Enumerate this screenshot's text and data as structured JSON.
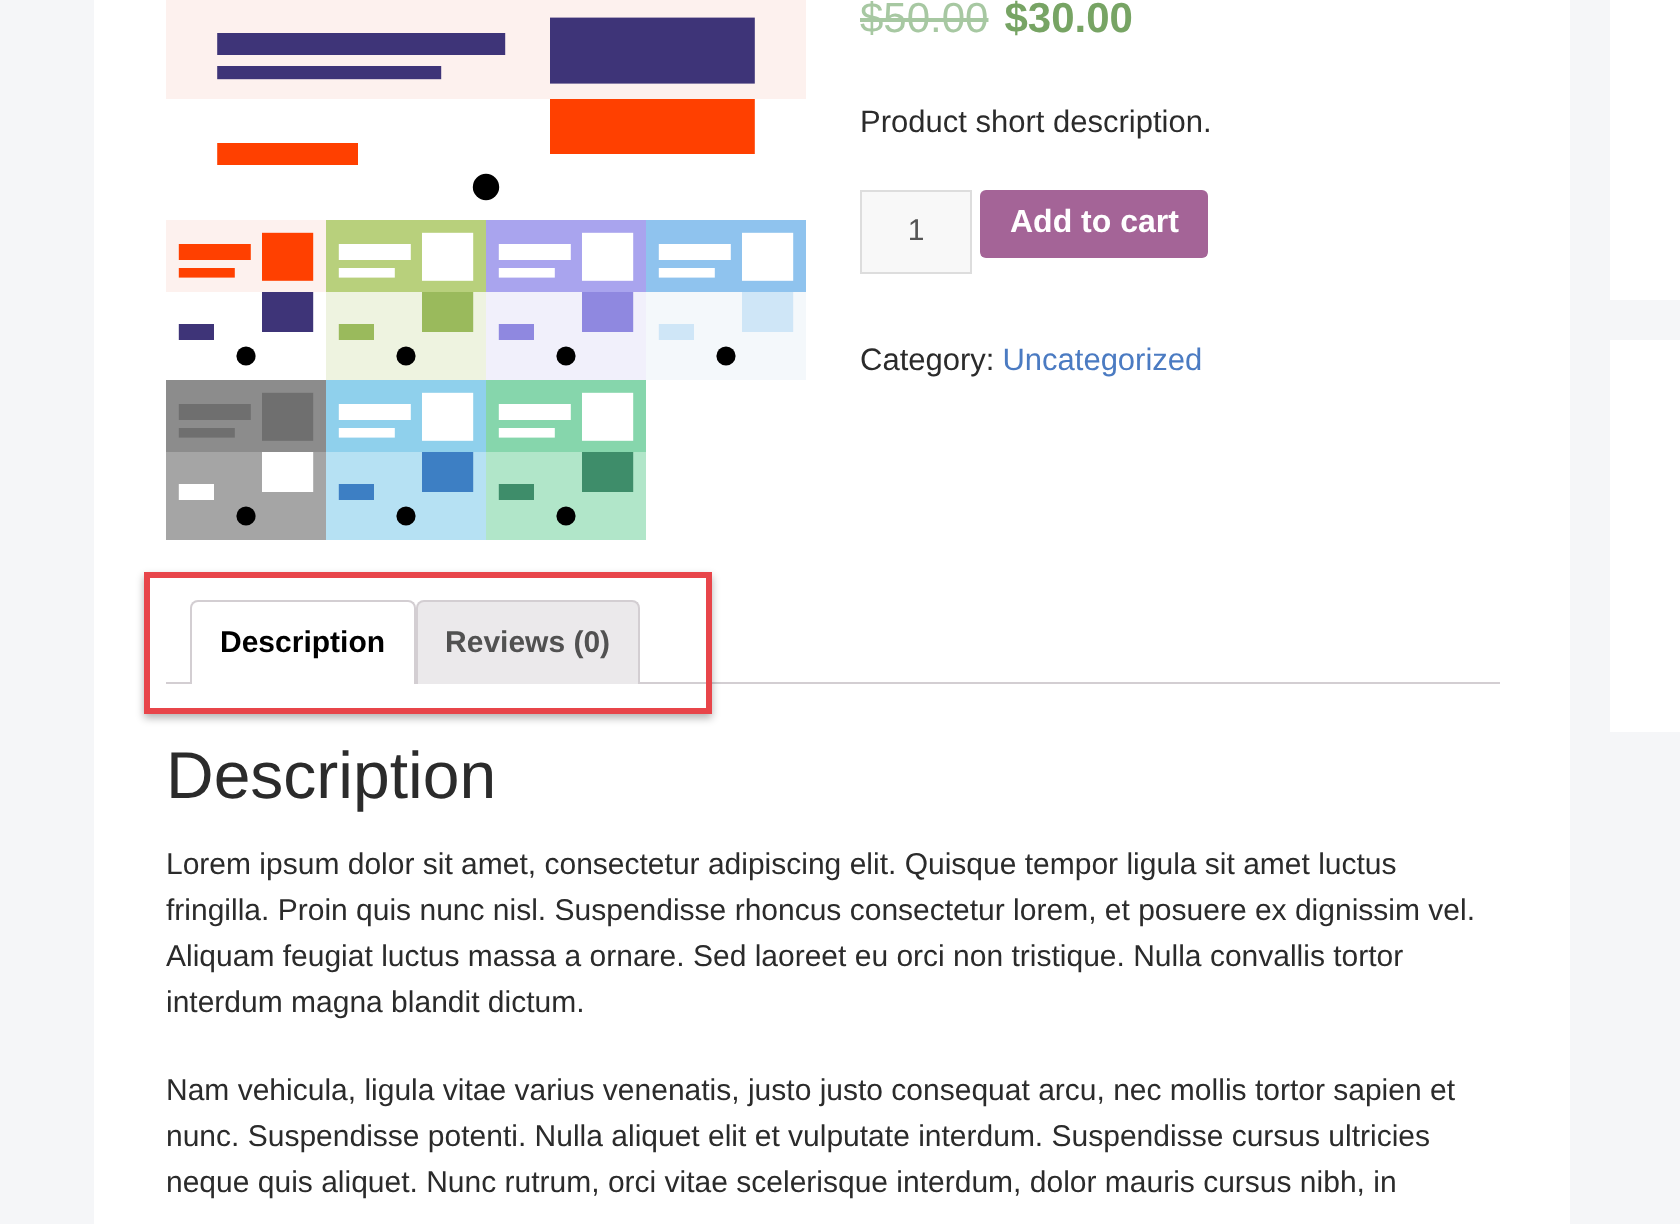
{
  "price": {
    "regular": "$50.00",
    "sale": "$30.00"
  },
  "short_description": "Product short description.",
  "quantity": "1",
  "add_to_cart": "Add to cart",
  "category": {
    "label": "Category:",
    "link": "Uncategorized"
  },
  "tabs": [
    {
      "label": "Description",
      "selected": true
    },
    {
      "label": "Reviews (0)",
      "selected": false
    }
  ],
  "highlight": {
    "on": true
  },
  "description": {
    "heading": "Description",
    "paragraphs": [
      "Lorem ipsum dolor sit amet, consectetur adipiscing elit. Quisque tempor ligula sit amet luctus fringilla. Proin quis nunc nisl. Suspendisse rhoncus consectetur lorem, et posuere ex dignissim vel. Aliquam feugiat luctus massa a ornare. Sed laoreet eu orci non tristique. Nulla convallis tortor interdum magna blandit dictum.",
      "Nam vehicula, ligula vitae varius venenatis, justo justo consequat arcu, nec mollis tortor sapien et nunc. Suspendisse potenti. Nulla aliquet elit et vulputate interdum. Suspendisse cursus ultricies neque quis aliquet. Nunc rutrum, orci vitae scelerisque interdum, dolor mauris cursus nibh, in"
    ]
  }
}
